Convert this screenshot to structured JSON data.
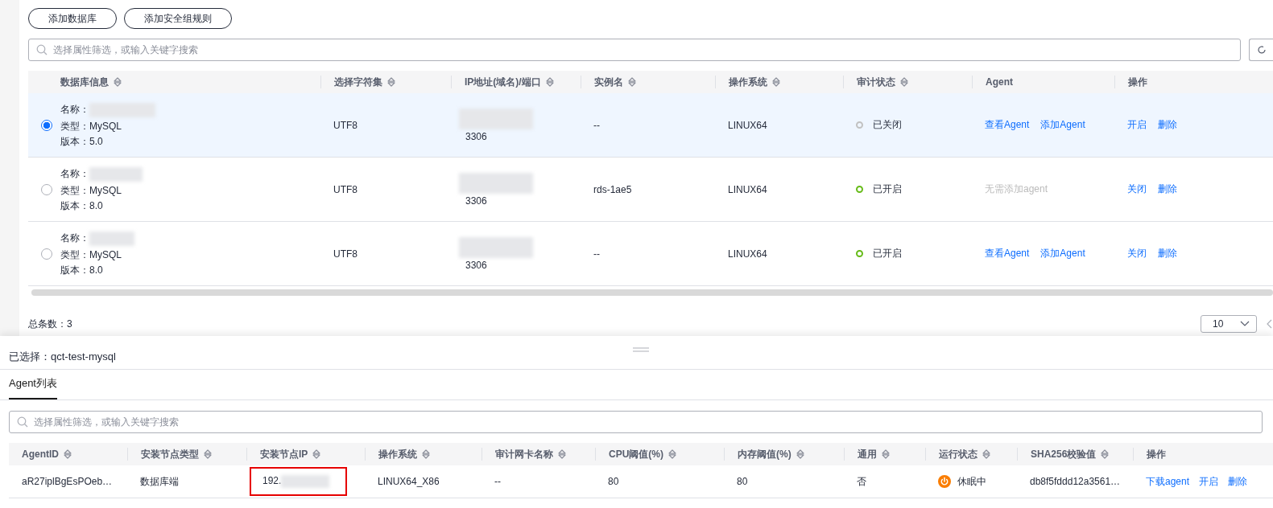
{
  "toolbar": {
    "buttons": [
      "添加数据库",
      "添加安全组规则"
    ]
  },
  "search": {
    "placeholder": "选择属性筛选，或输入关键字搜索"
  },
  "table": {
    "columns": [
      {
        "label": "数据库信息",
        "sortable": true
      },
      {
        "label": "选择字符集",
        "sortable": true
      },
      {
        "label": "IP地址(域名)/端口",
        "sortable": true
      },
      {
        "label": "实例名",
        "sortable": true
      },
      {
        "label": "操作系统",
        "sortable": true
      },
      {
        "label": "审计状态",
        "sortable": true
      },
      {
        "label": "Agent",
        "sortable": false
      },
      {
        "label": "操作",
        "sortable": false
      }
    ],
    "rows": [
      {
        "selected": true,
        "name": "名称：",
        "type": "类型：MySQL",
        "version": "版本：5.0",
        "charset": "UTF8",
        "port": "3306",
        "instance": "--",
        "os": "LINUX64",
        "audit": {
          "on": false,
          "label": "已关闭"
        },
        "agent": [
          {
            "label": "查看Agent",
            "disabled": false
          },
          {
            "label": "添加Agent",
            "disabled": false
          }
        ],
        "actions": [
          "开启",
          "删除"
        ]
      },
      {
        "selected": false,
        "name": "名称：",
        "type": "类型：MySQL",
        "version": "版本：8.0",
        "charset": "UTF8",
        "port": "3306",
        "instance": "rds-1ae5",
        "os": "LINUX64",
        "audit": {
          "on": true,
          "label": "已开启"
        },
        "agent": [
          {
            "label": "无需添加agent",
            "disabled": true
          }
        ],
        "actions": [
          "关闭",
          "删除"
        ]
      },
      {
        "selected": false,
        "name": "名称：",
        "type": "类型：MySQL",
        "version": "版本：8.0",
        "charset": "UTF8",
        "port": "3306",
        "instance": "--",
        "os": "LINUX64",
        "audit": {
          "on": true,
          "label": "已开启"
        },
        "agent": [
          {
            "label": "查看Agent",
            "disabled": false
          },
          {
            "label": "添加Agent",
            "disabled": false
          }
        ],
        "actions": [
          "关闭",
          "删除"
        ]
      }
    ]
  },
  "footer": {
    "total": "总条数：3",
    "page_size": "10"
  },
  "drawer": {
    "selection": "已选择：qct-test-mysql",
    "tabs": [
      {
        "label": "Agent列表",
        "selected": true
      }
    ],
    "search": {
      "placeholder": "选择属性筛选，或输入关键字搜索"
    },
    "columns": [
      {
        "label": "AgentID",
        "sortable": true
      },
      {
        "label": "安装节点类型",
        "sortable": true
      },
      {
        "label": "安装节点IP",
        "sortable": true
      },
      {
        "label": "操作系统",
        "sortable": true
      },
      {
        "label": "审计网卡名称",
        "sortable": true
      },
      {
        "label": "CPU阈值(%)",
        "sortable": true
      },
      {
        "label": "内存阈值(%)",
        "sortable": true
      },
      {
        "label": "通用",
        "sortable": true
      },
      {
        "label": "运行状态",
        "sortable": true
      },
      {
        "label": "SHA256校验值",
        "sortable": true
      },
      {
        "label": "操作",
        "sortable": false
      }
    ],
    "rows": [
      {
        "id": "aR27iplBgEsPOeb…",
        "node_type": "数据库端",
        "ip": "192.",
        "ip_highlighted": true,
        "os": "LINUX64_X86",
        "nic": "--",
        "cpu": "80",
        "mem": "80",
        "general": "否",
        "status": {
          "kind": "sleeping",
          "label": "休眠中"
        },
        "sha": "db8f5fddd12a3561…",
        "actions": [
          "下载agent",
          "开启",
          "删除"
        ]
      }
    ]
  }
}
